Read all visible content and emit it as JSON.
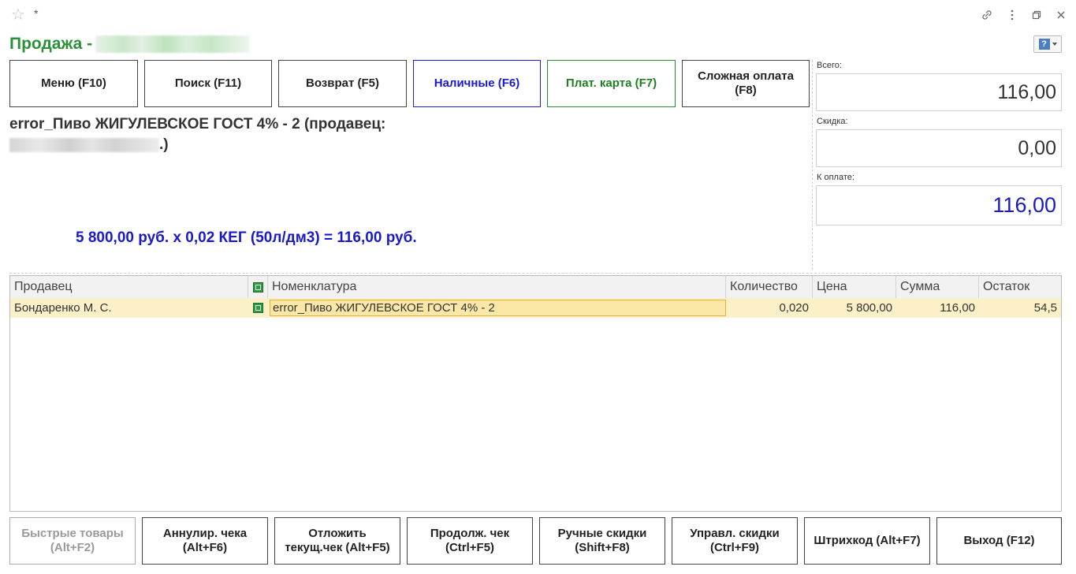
{
  "window": {
    "modified_mark": "*",
    "title_prefix": "Продажа -",
    "icons": {
      "favorite": "star-icon",
      "link": "link-icon",
      "more": "more-vertical-icon",
      "restore": "restore-window-icon",
      "close": "close-icon",
      "help": "help-icon"
    }
  },
  "actions": {
    "menu": "Меню (F10)",
    "search": "Поиск (F11)",
    "return": "Возврат (F5)",
    "cash": "Наличные (F6)",
    "card": "Плат. карта (F7)",
    "complex_payment": "Сложная оплата (F8)"
  },
  "product": {
    "name": "error_Пиво ЖИГУЛЕВСКОЕ ГОСТ 4% - 2 (продавец:",
    "seller_tail": ".)",
    "formula": "5 800,00 руб. х 0,02 КЕГ (50л/дм3) = 116,00 руб."
  },
  "totals": {
    "total_label": "Всего:",
    "total_value": "116,00",
    "discount_label": "Скидка:",
    "discount_value": "0,00",
    "pay_label": "К оплате:",
    "pay_value": "116,00"
  },
  "table": {
    "columns": {
      "seller": "Продавец",
      "item": "Номенклатура",
      "qty": "Количество",
      "price": "Цена",
      "sum": "Сумма",
      "rest": "Остаток"
    },
    "rows": [
      {
        "seller": "Бондаренко М. С.",
        "item": "error_Пиво ЖИГУЛЕВСКОЕ ГОСТ 4% - 2",
        "qty": "0,020",
        "price": "5 800,00",
        "sum": "116,00",
        "rest": "54,5"
      }
    ]
  },
  "footer": {
    "quick_goods": "Быстрые товары (Alt+F2)",
    "cancel_receipt": "Аннулир. чека (Alt+F6)",
    "postpone_receipt": "Отложить текущ.чек (Alt+F5)",
    "continue_receipt": "Продолж. чек (Ctrl+F5)",
    "manual_discounts": "Ручные скидки (Shift+F8)",
    "manage_discounts": "Управл. скидки (Ctrl+F9)",
    "barcode": "Штрихкод (Alt+F7)",
    "exit": "Выход (F12)"
  },
  "colors": {
    "title_green": "#2b9138",
    "cash_blue": "#1a1acc",
    "card_green": "#1f7f1f",
    "row_highlight": "#fbf0c7",
    "cell_focus": "#fbe8a6"
  }
}
